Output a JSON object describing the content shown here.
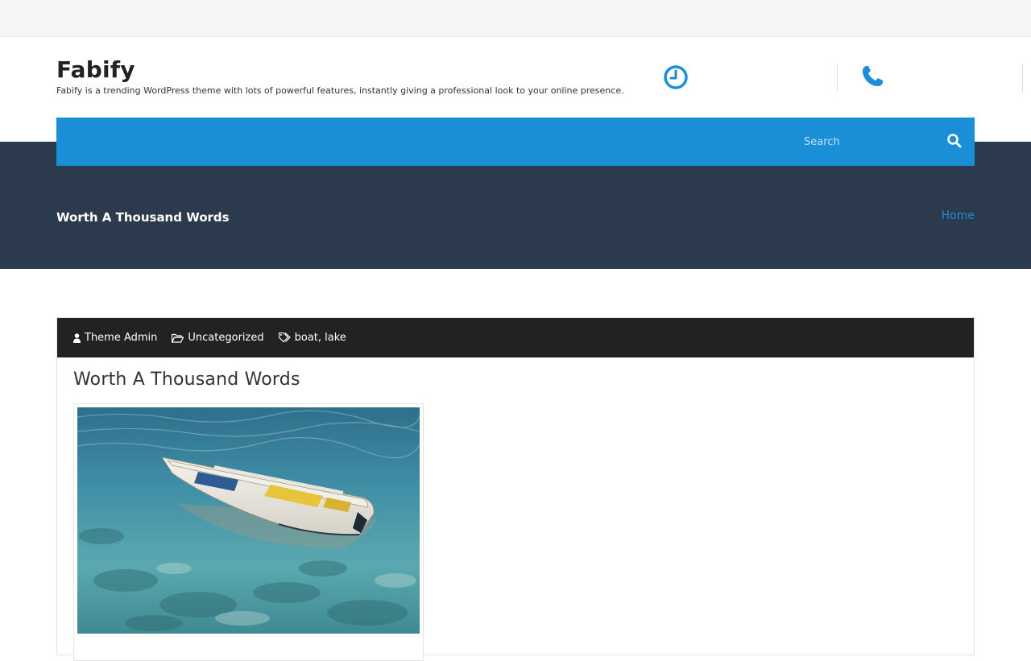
{
  "site": {
    "title": "Fabify",
    "tagline": "Fabify is a trending WordPress theme with lots of powerful features, instantly giving a professional look to your online presence."
  },
  "header_icons": [
    "clock-icon",
    "phone-icon"
  ],
  "search": {
    "placeholder": "Search",
    "button_icon": "search-icon"
  },
  "banner": {
    "title": "Worth A Thousand Words",
    "breadcrumb": "Home"
  },
  "post": {
    "meta": {
      "author": "Theme Admin",
      "category": "Uncategorized",
      "tags": [
        "boat",
        "lake"
      ],
      "tag_separator": ", "
    },
    "title": "Worth A Thousand Words",
    "image_icon": "boat-on-lake-image"
  },
  "colors": {
    "accent": "#1a8fd8",
    "banner_bg": "#2c3a4d",
    "meta_bar": "#222222",
    "topbar": "#f5f5f5"
  }
}
